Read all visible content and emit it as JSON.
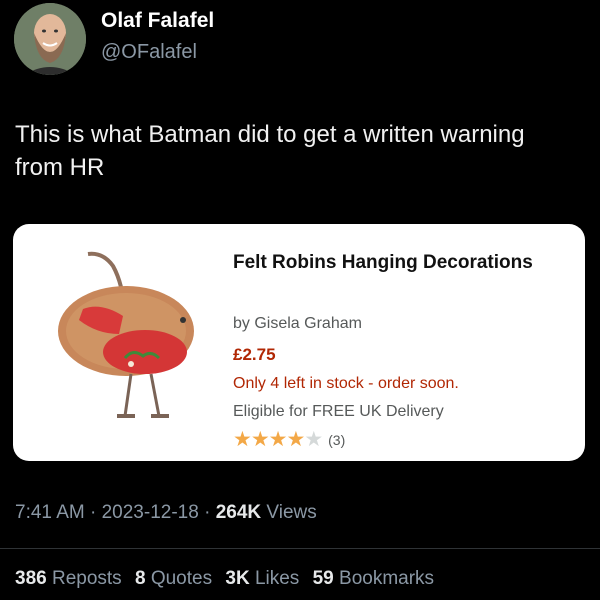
{
  "author": {
    "name": "Olaf Falafel",
    "handle": "@OFalafel"
  },
  "tweet": {
    "text": "This is what Batman did to get a written warning from HR"
  },
  "product_card": {
    "title": "Felt Robins Hanging Decorations",
    "brand": "by Gisela Graham",
    "price": "£2.75",
    "stock": "Only 4 left in stock - order soon.",
    "delivery": "Eligible for FREE UK Delivery",
    "rating_stars": 4,
    "rating_max": 5,
    "review_count": "(3)"
  },
  "meta": {
    "time": "7:41 AM",
    "date": "2023-12-18",
    "views_count": "264K",
    "views_label": "Views"
  },
  "stats": {
    "reposts_count": "386",
    "reposts_label": "Reposts",
    "quotes_count": "8",
    "quotes_label": "Quotes",
    "likes_count": "3K",
    "likes_label": "Likes",
    "bookmarks_count": "59",
    "bookmarks_label": "Bookmarks"
  },
  "colors": {
    "background": "#000000",
    "secondary_text": "#8b98a5",
    "price": "#b12704",
    "star": "#f3a847"
  }
}
